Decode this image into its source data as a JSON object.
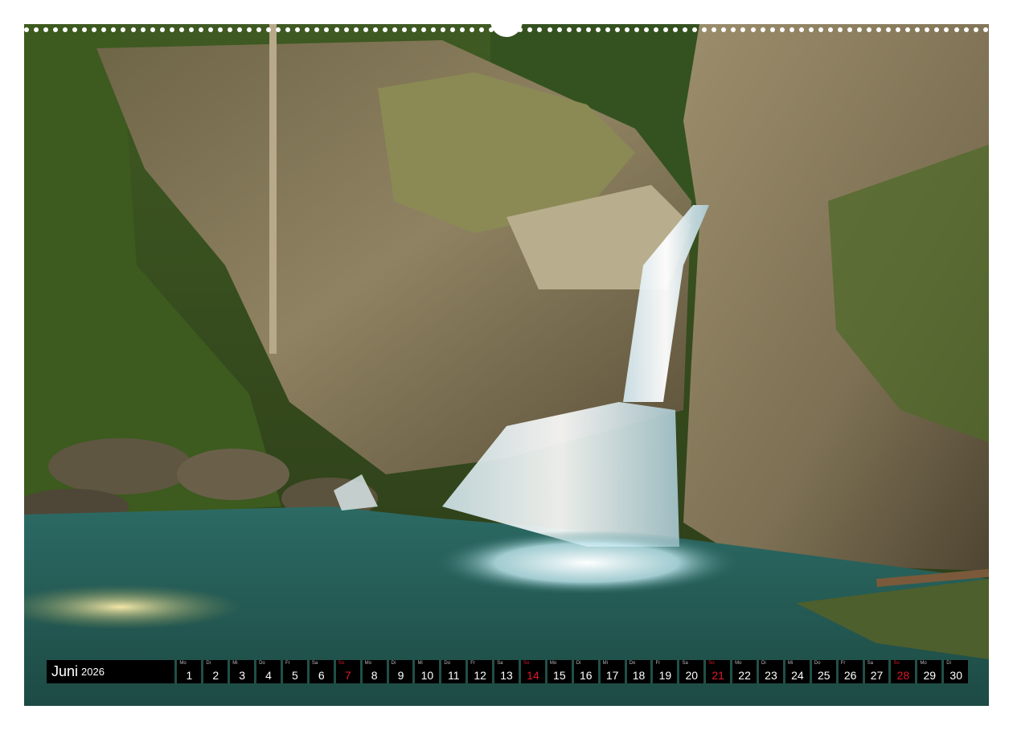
{
  "calendar": {
    "month": "Juni",
    "year": "2026",
    "days": [
      {
        "wd": "Mo",
        "n": "1",
        "sun": false
      },
      {
        "wd": "Di",
        "n": "2",
        "sun": false
      },
      {
        "wd": "Mi",
        "n": "3",
        "sun": false
      },
      {
        "wd": "Do",
        "n": "4",
        "sun": false
      },
      {
        "wd": "Fr",
        "n": "5",
        "sun": false
      },
      {
        "wd": "Sa",
        "n": "6",
        "sun": false
      },
      {
        "wd": "So",
        "n": "7",
        "sun": true
      },
      {
        "wd": "Mo",
        "n": "8",
        "sun": false
      },
      {
        "wd": "Di",
        "n": "9",
        "sun": false
      },
      {
        "wd": "Mi",
        "n": "10",
        "sun": false
      },
      {
        "wd": "Do",
        "n": "11",
        "sun": false
      },
      {
        "wd": "Fr",
        "n": "12",
        "sun": false
      },
      {
        "wd": "Sa",
        "n": "13",
        "sun": false
      },
      {
        "wd": "So",
        "n": "14",
        "sun": true
      },
      {
        "wd": "Mo",
        "n": "15",
        "sun": false
      },
      {
        "wd": "Di",
        "n": "16",
        "sun": false
      },
      {
        "wd": "Mi",
        "n": "17",
        "sun": false
      },
      {
        "wd": "Do",
        "n": "18",
        "sun": false
      },
      {
        "wd": "Fr",
        "n": "19",
        "sun": false
      },
      {
        "wd": "Sa",
        "n": "20",
        "sun": false
      },
      {
        "wd": "So",
        "n": "21",
        "sun": true
      },
      {
        "wd": "Mo",
        "n": "22",
        "sun": false
      },
      {
        "wd": "Di",
        "n": "23",
        "sun": false
      },
      {
        "wd": "Mi",
        "n": "24",
        "sun": false
      },
      {
        "wd": "Do",
        "n": "25",
        "sun": false
      },
      {
        "wd": "Fr",
        "n": "26",
        "sun": false
      },
      {
        "wd": "Sa",
        "n": "27",
        "sun": false
      },
      {
        "wd": "So",
        "n": "28",
        "sun": true
      },
      {
        "wd": "Mo",
        "n": "29",
        "sun": false
      },
      {
        "wd": "Di",
        "n": "30",
        "sun": false
      }
    ]
  },
  "colors": {
    "sunday": "#e0182a",
    "bar": "#000000",
    "water": "#2f6f6a",
    "rock": "#8a7a5a",
    "moss": "#5d7a2e"
  }
}
